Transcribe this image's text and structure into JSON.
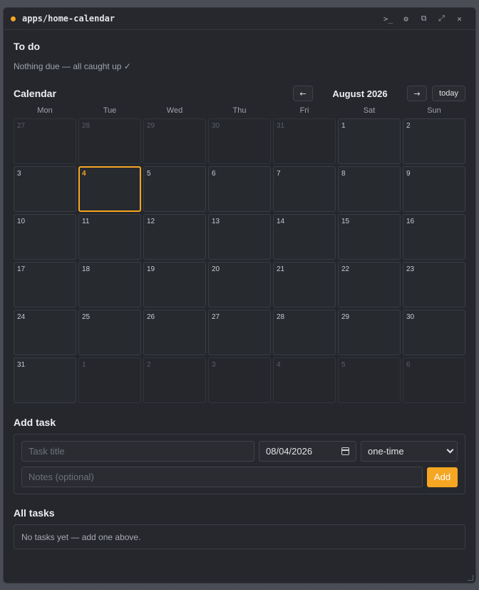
{
  "window": {
    "title": "apps/home-calendar",
    "accent_color": "#f5a623",
    "toolbar_icons": [
      ">_",
      "⚙",
      "⧉",
      "⤢",
      "✕"
    ]
  },
  "todo": {
    "heading": "To do",
    "empty_text": "Nothing due — all caught up ✓"
  },
  "calendar": {
    "heading": "Calendar",
    "month_label": "August 2026",
    "prev_label": "←",
    "next_label": "→",
    "today_label": "today",
    "weekdays": [
      "Mon",
      "Tue",
      "Wed",
      "Thu",
      "Fri",
      "Sat",
      "Sun"
    ],
    "weeks": [
      [
        {
          "d": "27",
          "out": true
        },
        {
          "d": "28",
          "out": true
        },
        {
          "d": "29",
          "out": true
        },
        {
          "d": "30",
          "out": true
        },
        {
          "d": "31",
          "out": true
        },
        {
          "d": "1"
        },
        {
          "d": "2"
        }
      ],
      [
        {
          "d": "3"
        },
        {
          "d": "4",
          "today": true
        },
        {
          "d": "5"
        },
        {
          "d": "6"
        },
        {
          "d": "7"
        },
        {
          "d": "8"
        },
        {
          "d": "9"
        }
      ],
      [
        {
          "d": "10"
        },
        {
          "d": "11"
        },
        {
          "d": "12"
        },
        {
          "d": "13"
        },
        {
          "d": "14"
        },
        {
          "d": "15"
        },
        {
          "d": "16"
        }
      ],
      [
        {
          "d": "17"
        },
        {
          "d": "18"
        },
        {
          "d": "19"
        },
        {
          "d": "20"
        },
        {
          "d": "21"
        },
        {
          "d": "22"
        },
        {
          "d": "23"
        }
      ],
      [
        {
          "d": "24"
        },
        {
          "d": "25"
        },
        {
          "d": "26"
        },
        {
          "d": "27"
        },
        {
          "d": "28"
        },
        {
          "d": "29"
        },
        {
          "d": "30"
        }
      ],
      [
        {
          "d": "31"
        },
        {
          "d": "1",
          "out": true
        },
        {
          "d": "2",
          "out": true
        },
        {
          "d": "3",
          "out": true
        },
        {
          "d": "4",
          "out": true
        },
        {
          "d": "5",
          "out": true
        },
        {
          "d": "6",
          "out": true
        }
      ]
    ]
  },
  "add_task": {
    "heading": "Add task",
    "title_placeholder": "Task title",
    "date_value": "08/04/2026",
    "repeat_value": "one-time",
    "notes_placeholder": "Notes (optional)",
    "add_label": "Add"
  },
  "all_tasks": {
    "heading": "All tasks",
    "empty_text": "No tasks yet — add one above."
  }
}
